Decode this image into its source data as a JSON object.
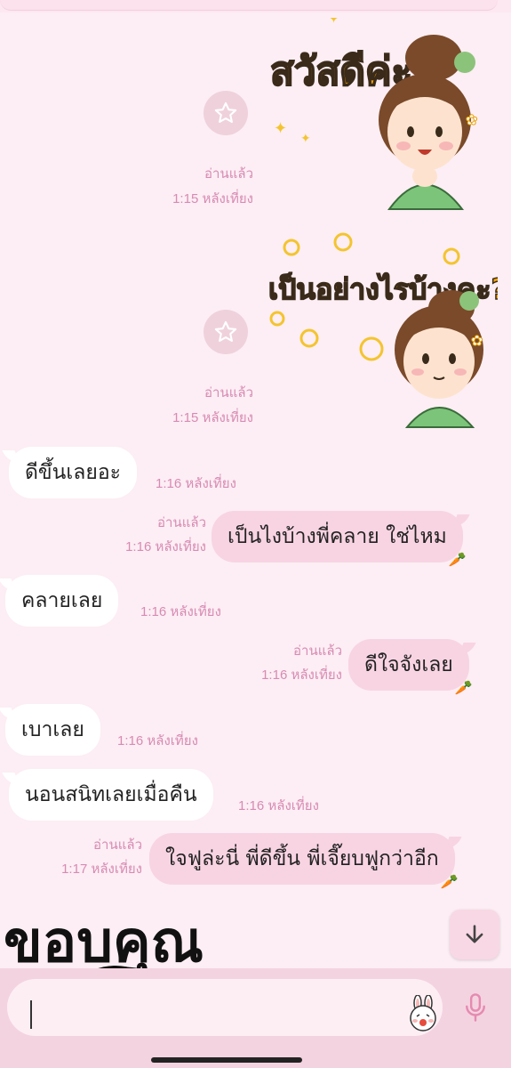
{
  "stickers": [
    {
      "caption": "สวัสดีค่ะ",
      "read": "อ่านแล้ว",
      "time": "1:15 หลังเที่ยง"
    },
    {
      "caption": "เป็นอย่างไรบ้างคะ?",
      "read": "อ่านแล้ว",
      "time": "1:15 หลังเที่ยง"
    }
  ],
  "messages": [
    {
      "text": "ดีขึ้นเลยอะ",
      "time": "1:16 หลังเที่ยง"
    },
    {
      "text": "เป็นไงบ้างพี่คลาย ใช่ไหม",
      "read": "อ่านแล้ว",
      "time": "1:16 หลังเที่ยง"
    },
    {
      "text": "คลายเลย",
      "time": "1:16 หลังเที่ยง"
    },
    {
      "text": "ดีใจจังเลย",
      "read": "อ่านแล้ว",
      "time": "1:16 หลังเที่ยง"
    },
    {
      "text": "เบาเลย",
      "time": "1:16 หลังเที่ยง"
    },
    {
      "text": "นอนสนิทเลยเมื่อคืน",
      "time": "1:16 หลังเที่ยง"
    },
    {
      "text": "ใจฟูล่ะนี่ พี่ดีขึ้น พี่เจี๊ยบฟูกว่าอีก",
      "read": "อ่านแล้ว",
      "time": "1:17 หลังเที่ยง"
    }
  ],
  "last_sticker_caption": "ขอบคุณ",
  "icons": {
    "star": "star-icon",
    "carrot": "carrot-icon",
    "scroll_down": "arrow-down-icon",
    "emoji": "bunny-sticker-icon",
    "mic": "microphone-icon"
  },
  "colors": {
    "background": "#fceef4",
    "outgoing_bubble": "#f8d4e3",
    "incoming_bubble": "#ffffff",
    "meta_text": "#d88ab3",
    "composer": "#f4d3e0"
  }
}
